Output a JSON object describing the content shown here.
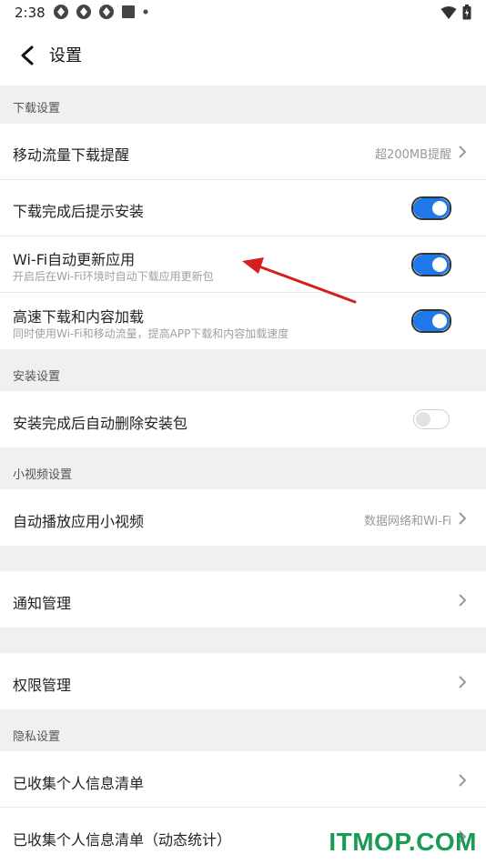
{
  "status_bar": {
    "time": "2:38"
  },
  "header": {
    "title": "设置"
  },
  "sections": {
    "download": "下载设置",
    "install": "安装设置",
    "video": "小视频设置",
    "privacy": "隐私设置"
  },
  "rows": {
    "mobile_data": {
      "title": "移动流量下载提醒",
      "value": "超200MB提醒"
    },
    "install_prompt": {
      "title": "下载完成后提示安装",
      "toggle": "on"
    },
    "wifi_update": {
      "title": "Wi-Fi自动更新应用",
      "subtitle": "开启后在Wi-Fi环境时自动下载应用更新包",
      "toggle": "on"
    },
    "fast_download": {
      "title": "高速下载和内容加载",
      "subtitle": "同时使用Wi-Fi和移动流量，提高APP下载和内容加载速度",
      "toggle": "on"
    },
    "auto_delete": {
      "title": "安装完成后自动删除安装包",
      "toggle": "off"
    },
    "auto_play": {
      "title": "自动播放应用小视频",
      "value": "数据网络和Wi-Fi"
    },
    "notifications": {
      "title": "通知管理"
    },
    "permissions": {
      "title": "权限管理"
    },
    "collected_info": {
      "title": "已收集个人信息清单"
    },
    "collected_info_dynamic": {
      "title": "已收集个人信息清单（动态统计）"
    }
  },
  "watermark": "ITMOP.COM",
  "colors": {
    "accent": "#1f78e8",
    "annotation_arrow": "#d42020",
    "watermark": "#1a9a52"
  }
}
